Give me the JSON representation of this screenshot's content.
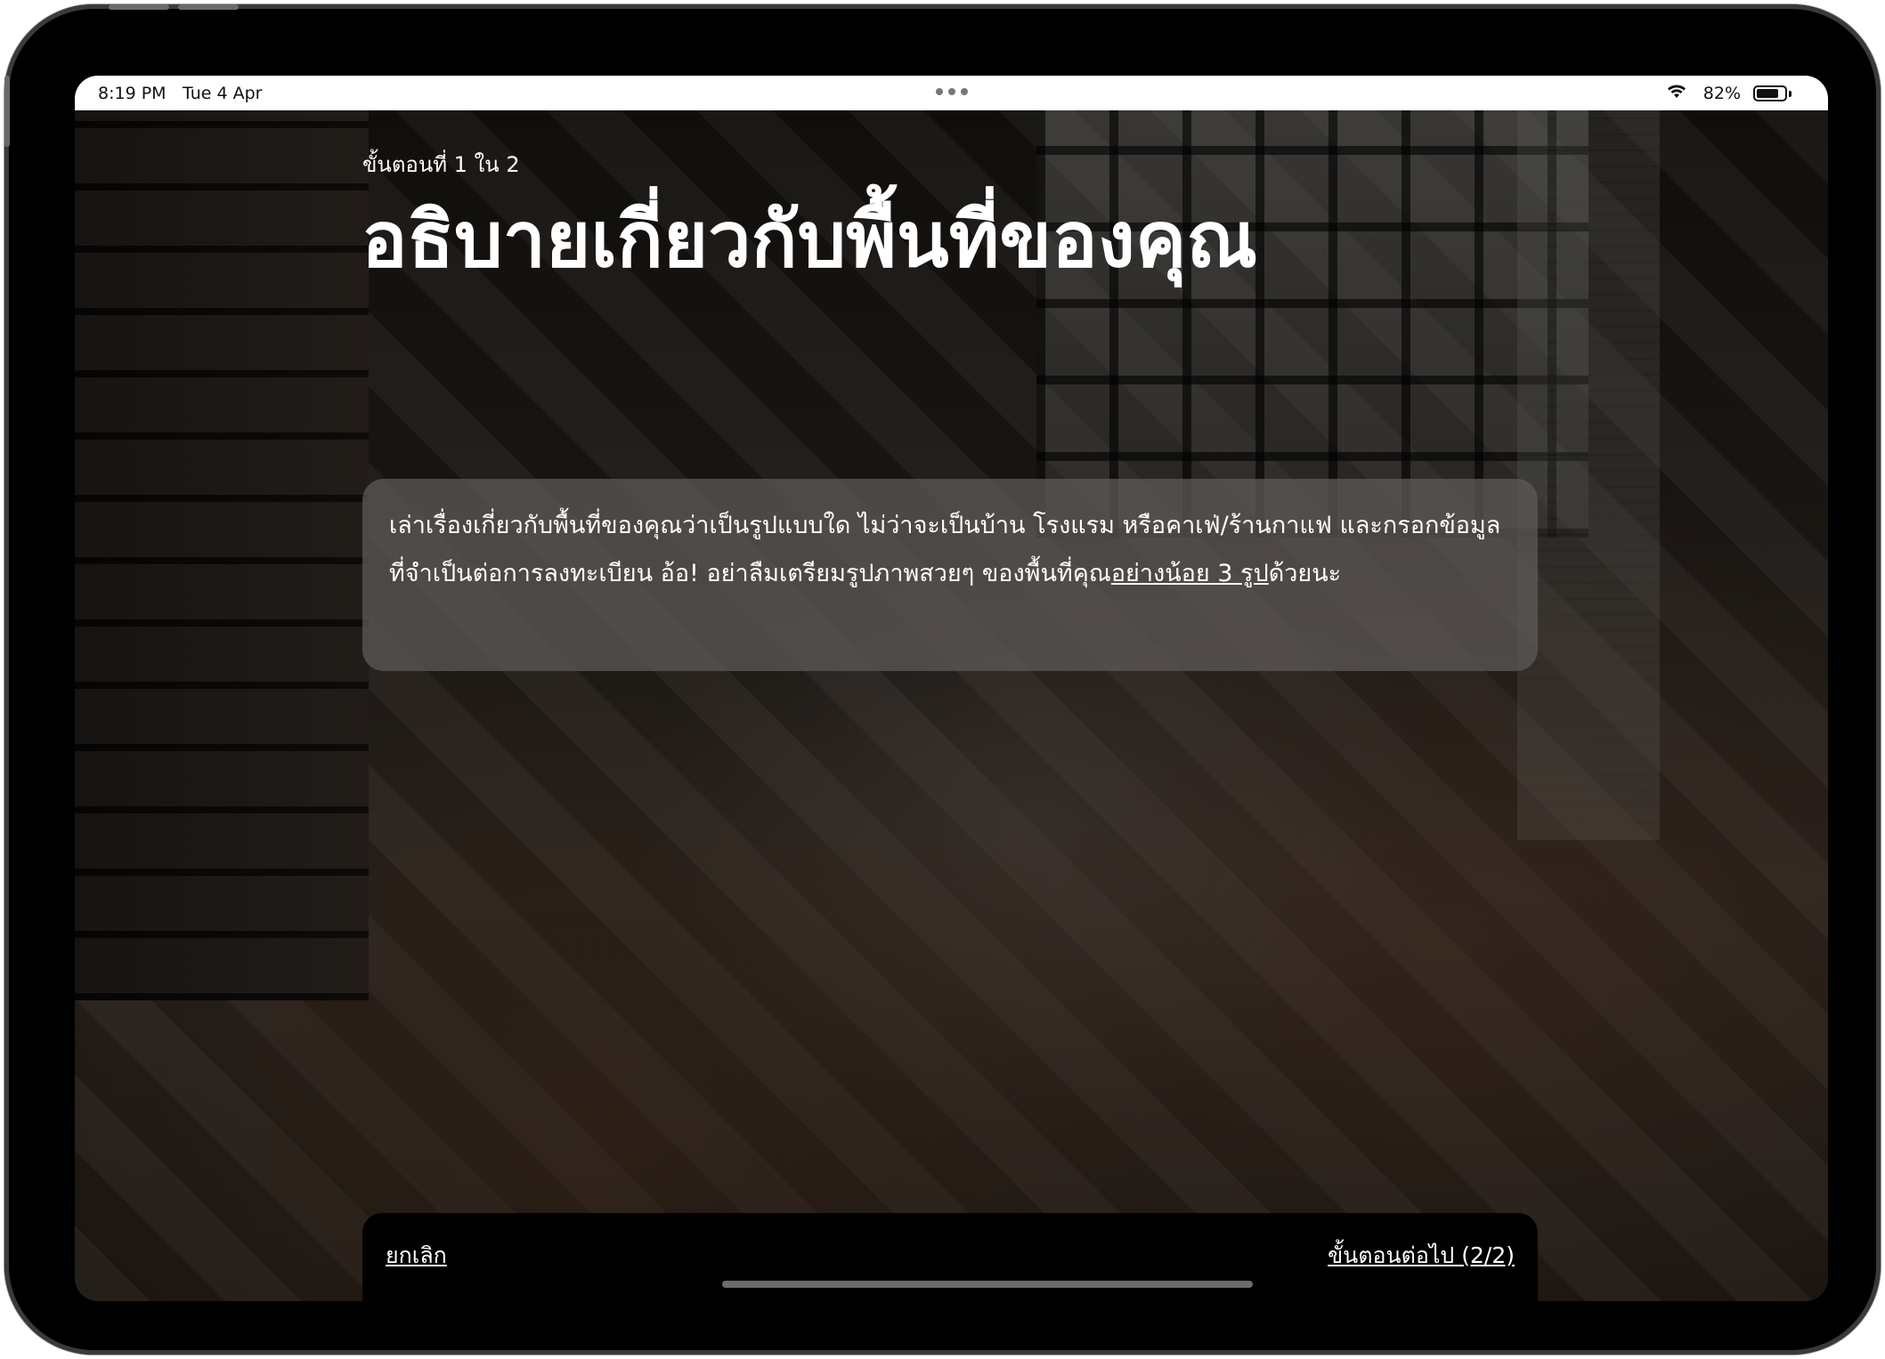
{
  "status_bar": {
    "time": "8:19 PM",
    "date": "Tue 4 Apr",
    "battery_percent": "82%",
    "battery_level": 0.82
  },
  "step": {
    "label": "ขั้นตอนที่ 1 ใน 2"
  },
  "title": "อธิบายเกี่ยวกับพื้นที่ของคุณ",
  "description": {
    "text": "เล่าเรื่องเกี่ยวกับพื้นที่ของคุณว่าเป็นรูปแบบใด ไม่ว่าจะเป็นบ้าน โรงแรม หรือคาเฟ่/ร้านกาแฟ และกรอกข้อมูลที่จำเป็นต่อการลงทะเบียน อ้อ! อย่าลืมเตรียมรูปภาพสวยๆ ของพื้นที่คุณ",
    "link_text": "อย่างน้อย 3 รูป",
    "suffix": "ด้วยนะ"
  },
  "footer": {
    "cancel_label": "ยกเลิก",
    "next_label": "ขั้นตอนต่อไป (2/2)"
  },
  "colors": {
    "card_background": "#5f5c5a",
    "bar_background": "#000000",
    "text": "#ffffff"
  }
}
